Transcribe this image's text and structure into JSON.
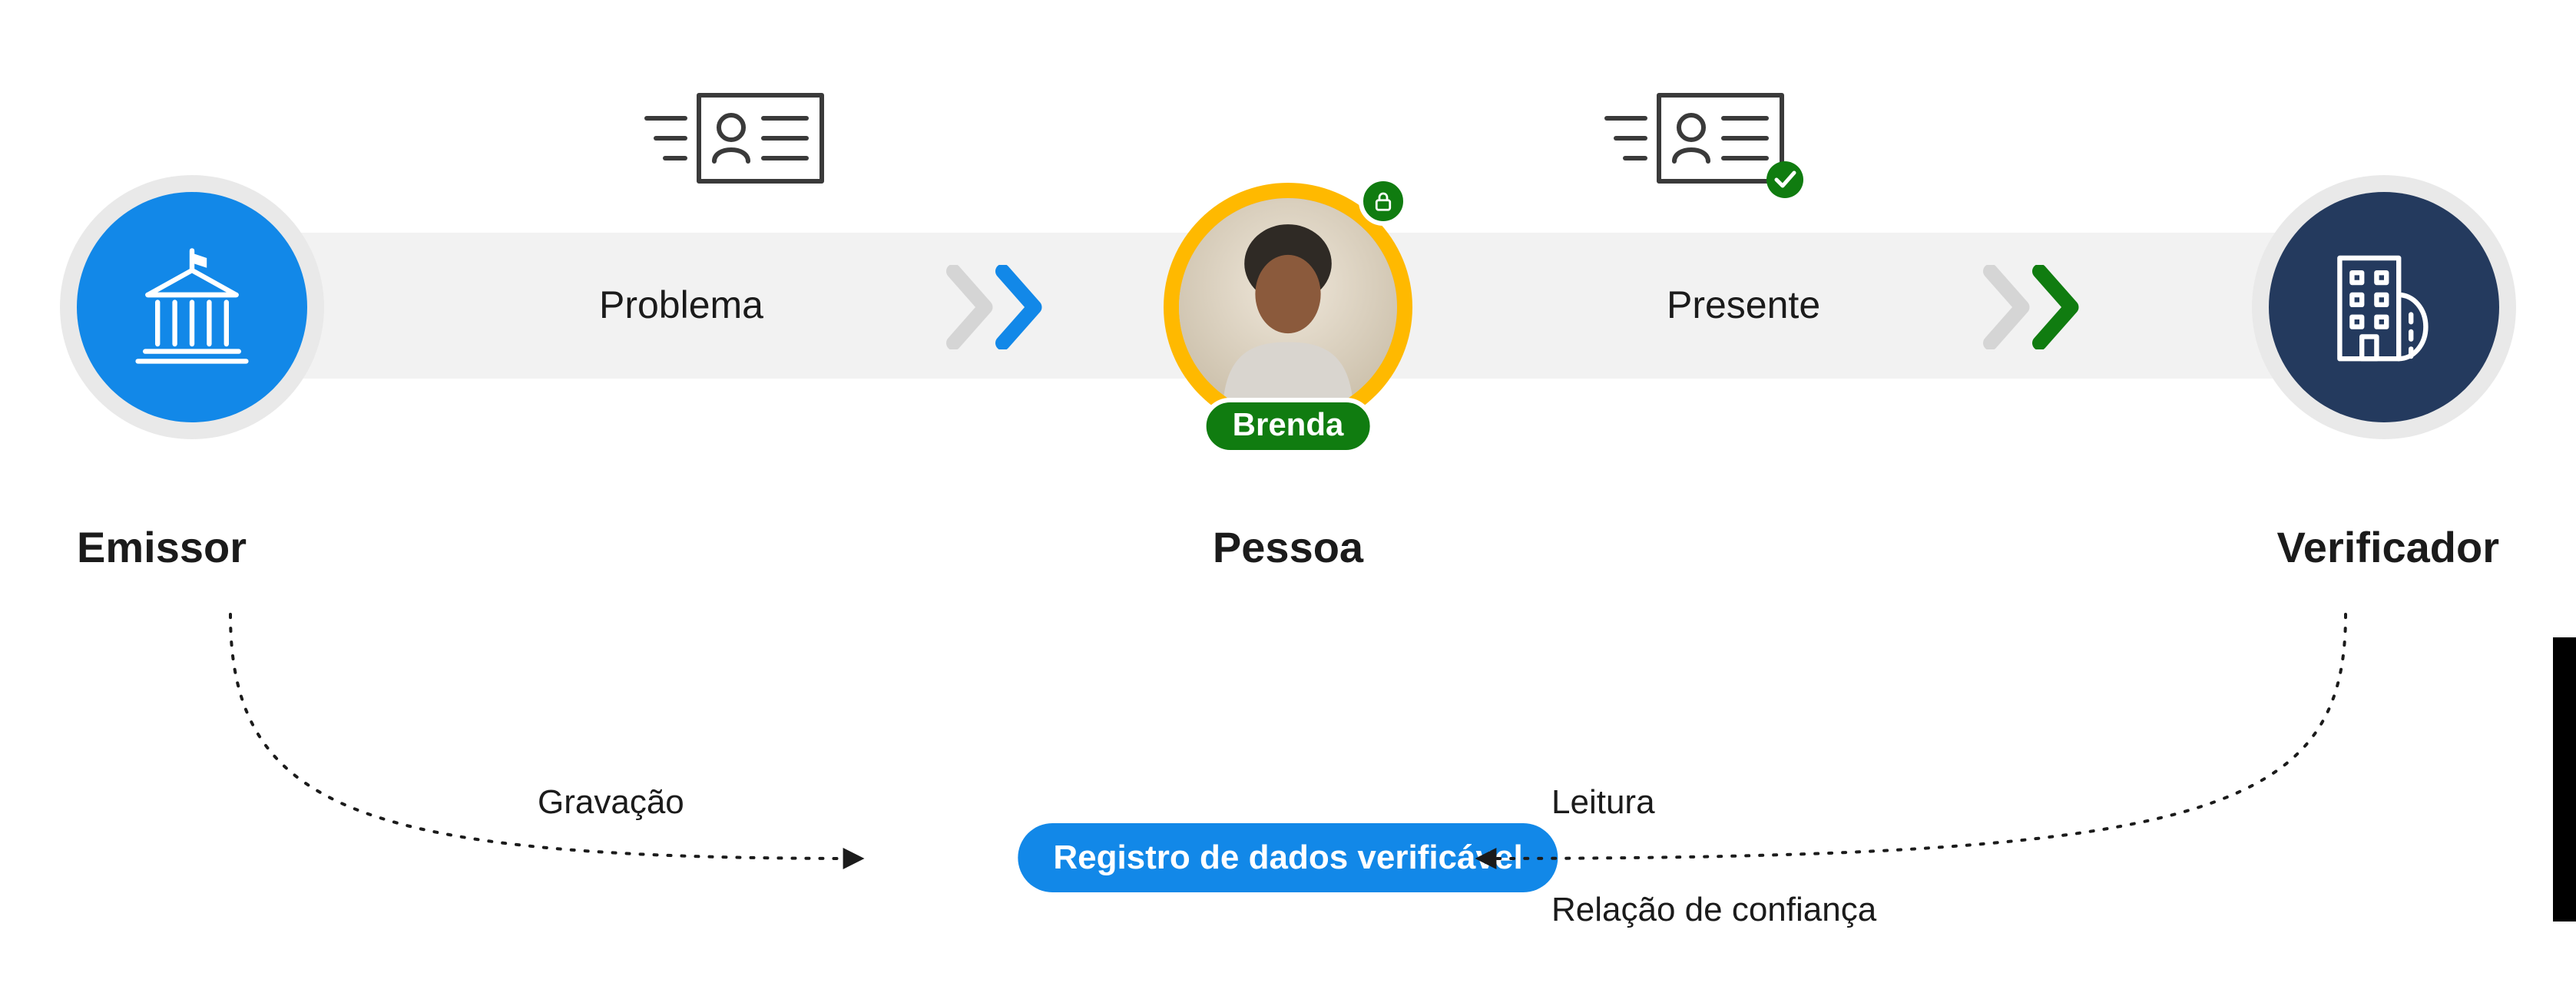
{
  "issuer": {
    "role": "Emissor"
  },
  "person": {
    "role": "Pessoa",
    "name": "Brenda"
  },
  "verifier": {
    "role": "Verificador"
  },
  "flow": {
    "issue": "Problema",
    "present": "Presente"
  },
  "registry": {
    "pill": "Registro de dados verificável",
    "write": "Gravação",
    "read": "Leitura",
    "trust": "Relação de confiança"
  },
  "colors": {
    "blue": "#1288e8",
    "navy": "#243a5e",
    "green": "#107c10",
    "yellow": "#ffb900",
    "grey": "#d5d5d5"
  }
}
